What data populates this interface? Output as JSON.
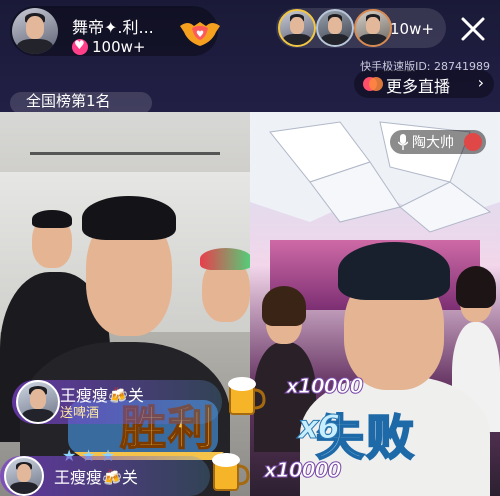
{
  "header": {
    "anchor_name": "舞帝✦.利...",
    "likes": "100w+",
    "viewer_count": "10w+",
    "room_id": "快手极速版ID: 28741989",
    "more_live_label": "更多直播",
    "rank_text": "全国榜第1名"
  },
  "right_stream": {
    "streamer_name": "陶大帅"
  },
  "gifts": [
    {
      "sender": "王瘦瘦🍻关",
      "subtitle": "送啤酒",
      "count": "x10000"
    },
    {
      "sender": "王瘦瘦🍻关",
      "subtitle": "",
      "count": "x10000"
    }
  ],
  "pk": {
    "left_result": "胜利",
    "right_result": "失败",
    "right_count_digit": "x6"
  },
  "colors": {
    "topbar": "#1c1b3a",
    "accent_pink": "#ff3f8a",
    "win_gold": "#f5c24a",
    "lose_blue": "#6fd1ff"
  }
}
